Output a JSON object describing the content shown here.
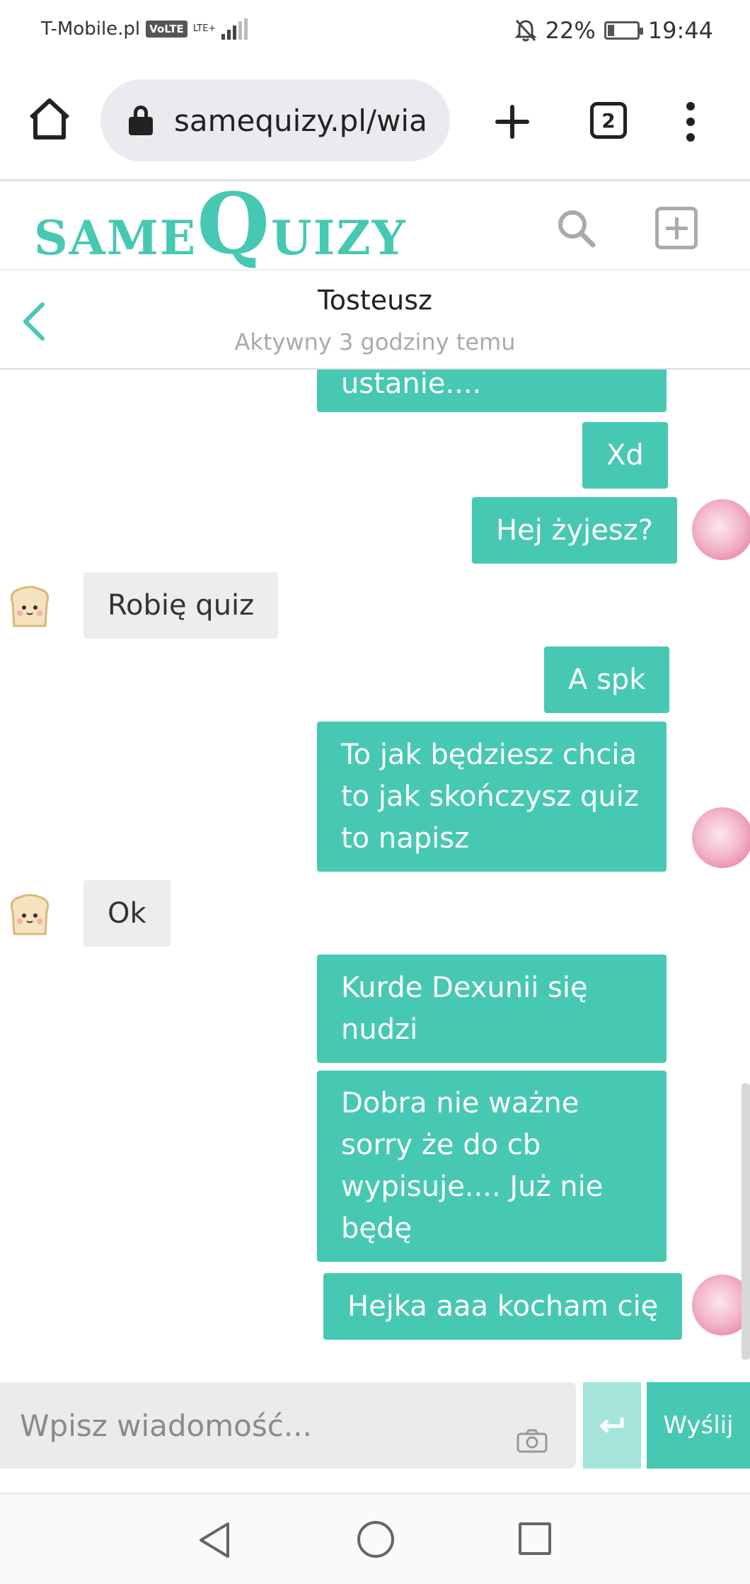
{
  "status_bar": {
    "carrier": "T-Mobile.pl",
    "volte_badge": "VoLTE",
    "network_type": "LTE+",
    "battery_percent": "22%",
    "battery_level": 0.22,
    "time": "19:44",
    "icons": [
      "signal-icon",
      "alarm-off-icon",
      "battery-icon"
    ]
  },
  "browser": {
    "url": "samequizy.pl/wia",
    "tab_count": "2",
    "icons": [
      "home-icon",
      "lock-icon",
      "new-tab-icon",
      "tabs-icon",
      "menu-icon"
    ]
  },
  "site": {
    "logo_same": "same",
    "logo_quizy": "Quizy",
    "brand_color": "#47c8b2",
    "icons": [
      "search-icon",
      "add-quiz-icon"
    ]
  },
  "conversation": {
    "name": "Tosteusz",
    "status": "Aktywny 3 godziny temu",
    "messages": [
      {
        "from": "me",
        "text": "ustanie...."
      },
      {
        "from": "me",
        "text": "Xd"
      },
      {
        "from": "me",
        "text": "Hej żyjesz?"
      },
      {
        "from": "them",
        "text": "Robię quiz"
      },
      {
        "from": "me",
        "text": "A spk"
      },
      {
        "from": "me",
        "lines": [
          "To jak będziesz chcia",
          "to jak skończysz quiz",
          "to napisz"
        ]
      },
      {
        "from": "them",
        "text": "Ok"
      },
      {
        "from": "me",
        "lines": [
          "Kurde Dexunii się",
          "nudzi"
        ]
      },
      {
        "from": "me",
        "lines": [
          "Dobra nie ważne",
          "sorry że do cb",
          "wypisuje.... Już nie",
          "będę"
        ]
      },
      {
        "from": "me",
        "text": "Hejka aaa kocham cię"
      }
    ],
    "outgoing_color": "#47c8b2",
    "incoming_color": "#ededed"
  },
  "composer": {
    "placeholder": "Wpisz wiadomość...",
    "send_label": "Wyślij",
    "icons": [
      "camera-icon",
      "enter-icon"
    ]
  },
  "navigation": {
    "icons": [
      "back-icon",
      "home-circle-icon",
      "recents-icon"
    ]
  }
}
